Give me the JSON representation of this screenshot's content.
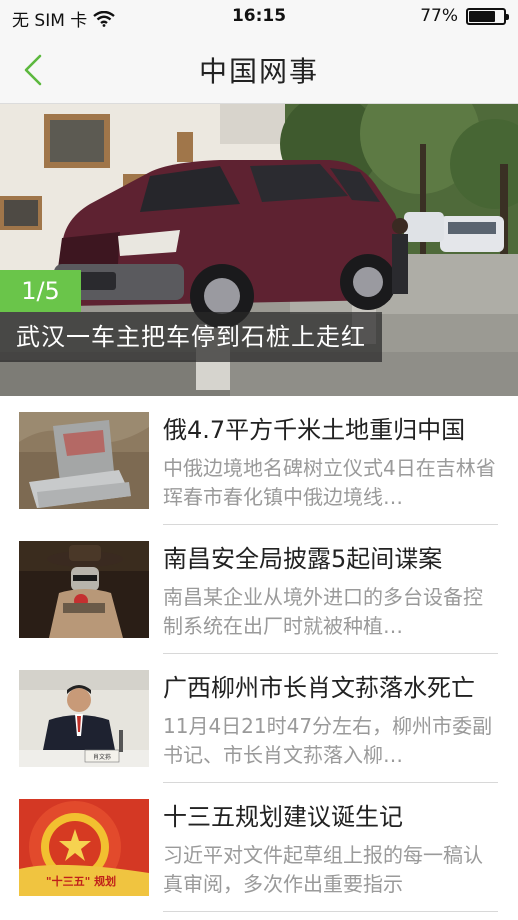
{
  "status_bar": {
    "carrier": "无 SIM 卡",
    "time": "16:15",
    "battery": "77%",
    "battery_level": 0.77
  },
  "nav": {
    "title": "中国网事"
  },
  "hero": {
    "index": "1/5",
    "caption": "武汉一车主把车停到石桩上走红"
  },
  "news": [
    {
      "title": "俄4.7平方千米土地重归中国",
      "desc": "中俄边境地名碑树立仪式4日在吉林省珲春市春化镇中俄边境线…"
    },
    {
      "title": "南昌安全局披露5起间谍案",
      "desc": "南昌某企业从境外进口的多台设备控制系统在出厂时就被种植…"
    },
    {
      "title": "广西柳州市长肖文荪落水死亡",
      "desc": "11月4日21时47分左右，柳州市委副书记、市长肖文荪落入柳…"
    },
    {
      "title": "十三五规划建议诞生记",
      "desc": "习近平对文件起草组上报的每一稿认真审阅，多次作出重要指示"
    }
  ],
  "thumb_texts": {
    "nameplate": "肖文荪",
    "plan": "\"十三五\" 规划"
  }
}
